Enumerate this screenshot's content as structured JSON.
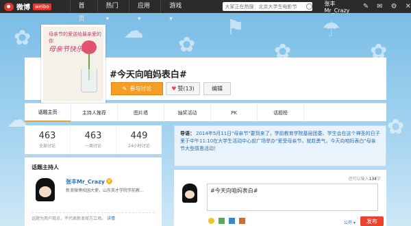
{
  "topbar": {
    "logo_text": "微博",
    "logo_badge": "weibo",
    "nav": [
      "首页",
      "热门 ▾",
      "应用 ▾",
      "游戏 ▾"
    ],
    "search_placeholder": "大家正在热搜：北京大学生电影节",
    "user_name": "张丰Mr_Crazy",
    "icons": [
      "edit-icon",
      "mail-icon",
      "gear-icon",
      "close-icon"
    ]
  },
  "cover": {
    "caption_line1": "母亲节的爱送给最亲爱的你",
    "caption_line2": "母亲节快乐"
  },
  "topic": {
    "title": "#今天向咱妈表白#",
    "join_label": "参与讨论",
    "like_label": "赞(13)",
    "edit_label": "编辑"
  },
  "tabs": [
    "话题主页",
    "主持人推荐",
    "图片墙",
    "抽奖活动",
    "PK",
    "话题榜"
  ],
  "stats": [
    {
      "num": "463",
      "label": "全部讨论"
    },
    {
      "num": "463",
      "label": "一周讨论"
    },
    {
      "num": "449",
      "label": "24小时讨论"
    }
  ],
  "host": {
    "title": "话题主持人",
    "name": "张丰Mr_Crazy",
    "badge": "V",
    "desc": "新浪微博校园大使，山东英才学院学前教...",
    "note": "话题为用户观点，不代表新浪官方立场。",
    "note_link": "详情"
  },
  "intro": {
    "lead": "导语：",
    "text": "2014年5月11日\"母亲节\"要到来了，学前教育学院基层团委、学生会在这个神圣的日子里于中午11:10在大学生活动中心前广场举办\"爱受母亲节，就趁勇气，今天向咱妈表白\"母亲节大型感恩活动！"
  },
  "post": {
    "counter_prefix": "还可以输入",
    "counter_num": "134",
    "counter_suffix": "字",
    "text": "#今天向咱妈表白#",
    "publish_scope": "公开 ▾",
    "send_label": "发布"
  }
}
